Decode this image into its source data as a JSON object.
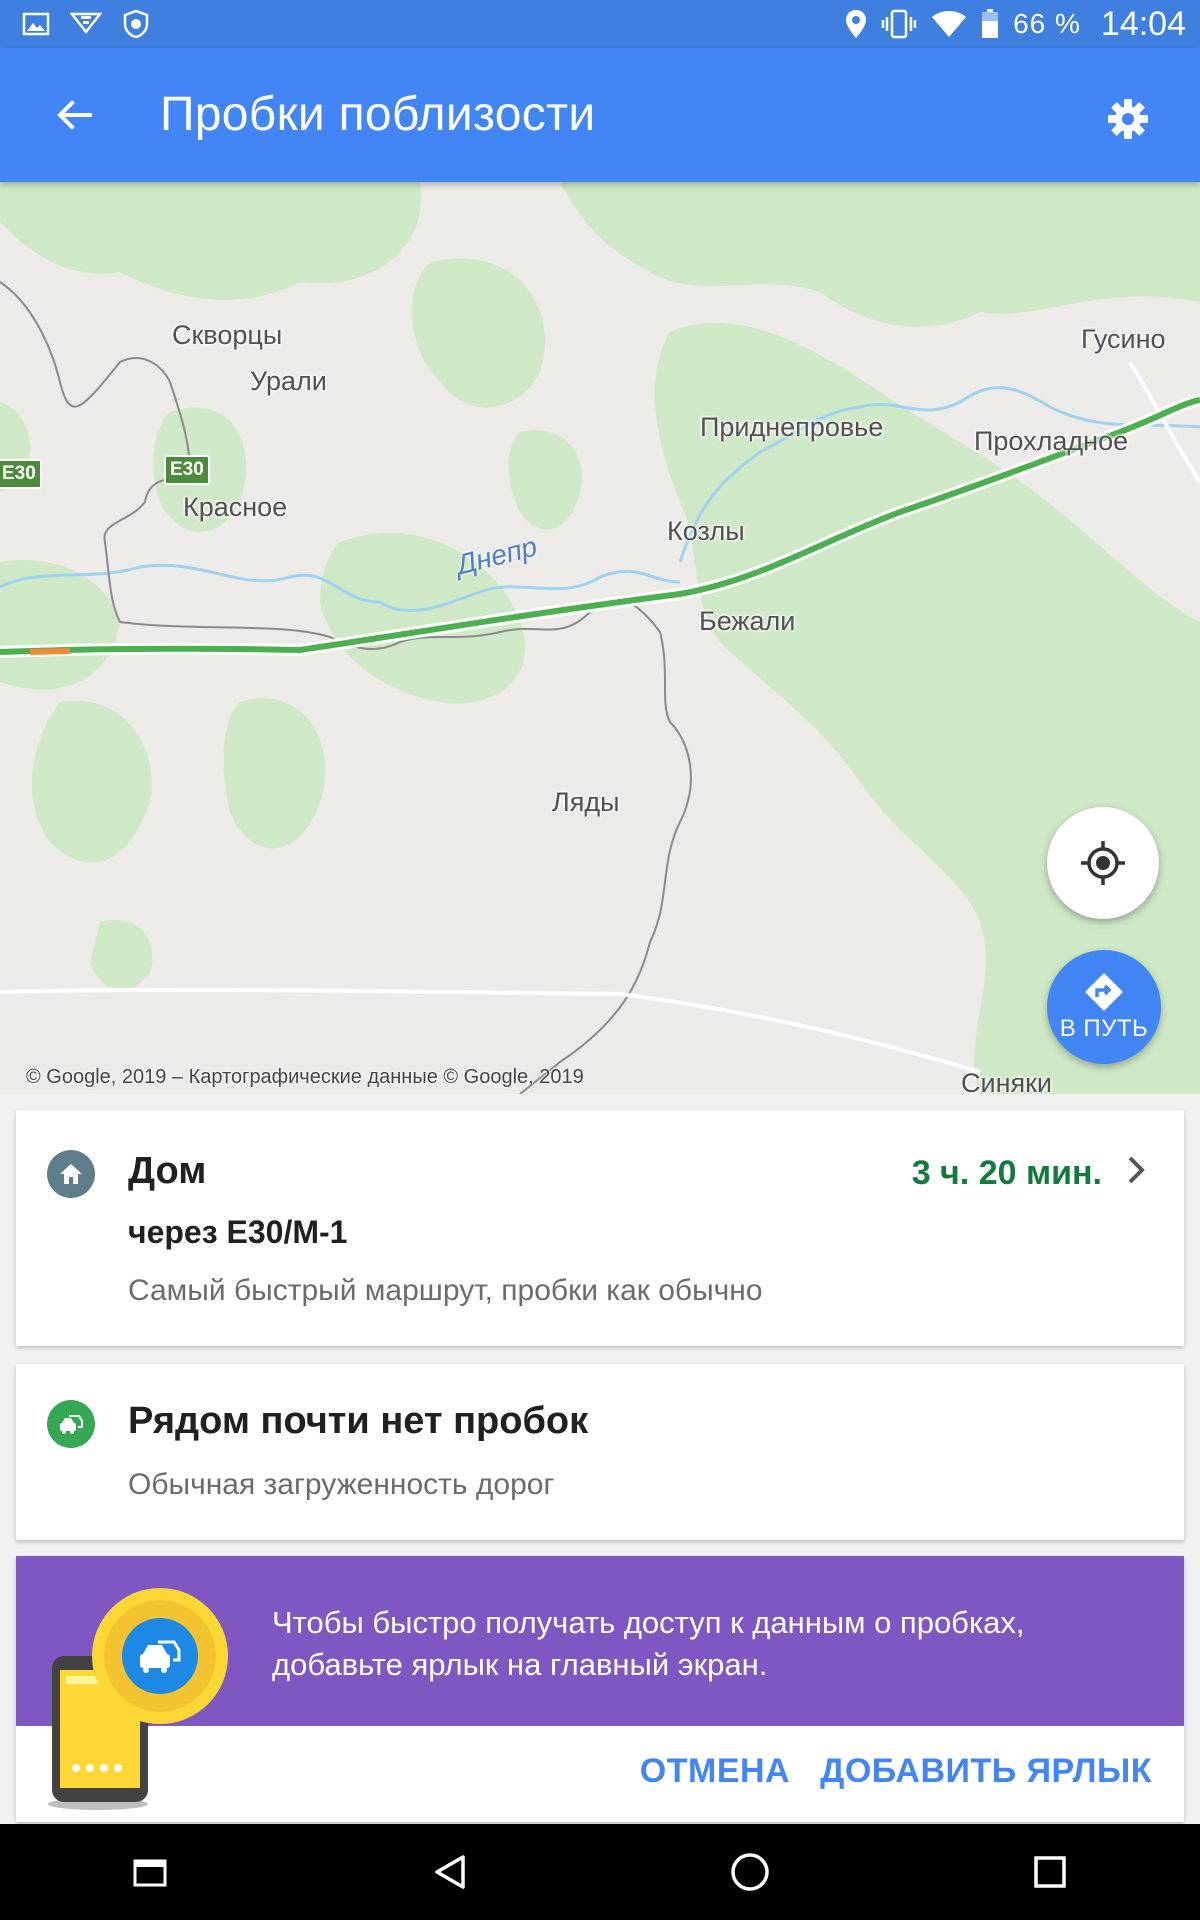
{
  "status_bar": {
    "icons": [
      "image-icon",
      "wifi-download-icon",
      "shield-app-icon",
      "location-icon",
      "vibrate-icon",
      "wifi-icon",
      "battery-icon"
    ],
    "battery_percent": "66 %",
    "time": "14:04"
  },
  "toolbar": {
    "title": "Пробки поблизости",
    "back_icon": "arrow-back-icon",
    "settings_icon": "gear-icon",
    "color": "#4285f4"
  },
  "map": {
    "places": [
      "Скворцы",
      "Урали",
      "Красное",
      "Приднепровье",
      "Гусино",
      "Прохладное",
      "Козлы",
      "Бежали",
      "Ляды",
      "Синяки"
    ],
    "road_shields": [
      "E30",
      "E30"
    ],
    "river": "Днепр",
    "copyright": "© Google, 2019 – Картографические данные © Google, 2019",
    "go_button": "В ПУТЬ",
    "traffic_color": "#4caf50"
  },
  "home_card": {
    "title": "Дом",
    "route": "через E30/M-1",
    "description": "Самый быстрый маршрут, пробки как обычно",
    "duration": "3 ч. 20 мин.",
    "duration_color": "#137a3f"
  },
  "traffic_card": {
    "title": "Рядом почти нет пробок",
    "description": "Обычная загруженность дорог"
  },
  "promo": {
    "text": "Чтобы быстро получать доступ к данным о пробках, добавьте ярлык на главный экран.",
    "cancel": "ОТМЕНА",
    "add_shortcut": "ДОБАВИТЬ ЯРЛЫК",
    "band_color": "#7e57c2"
  },
  "nav_bar": {
    "icons": [
      "recents-icon",
      "back-triangle-icon",
      "home-circle-icon",
      "overview-square-icon"
    ]
  }
}
